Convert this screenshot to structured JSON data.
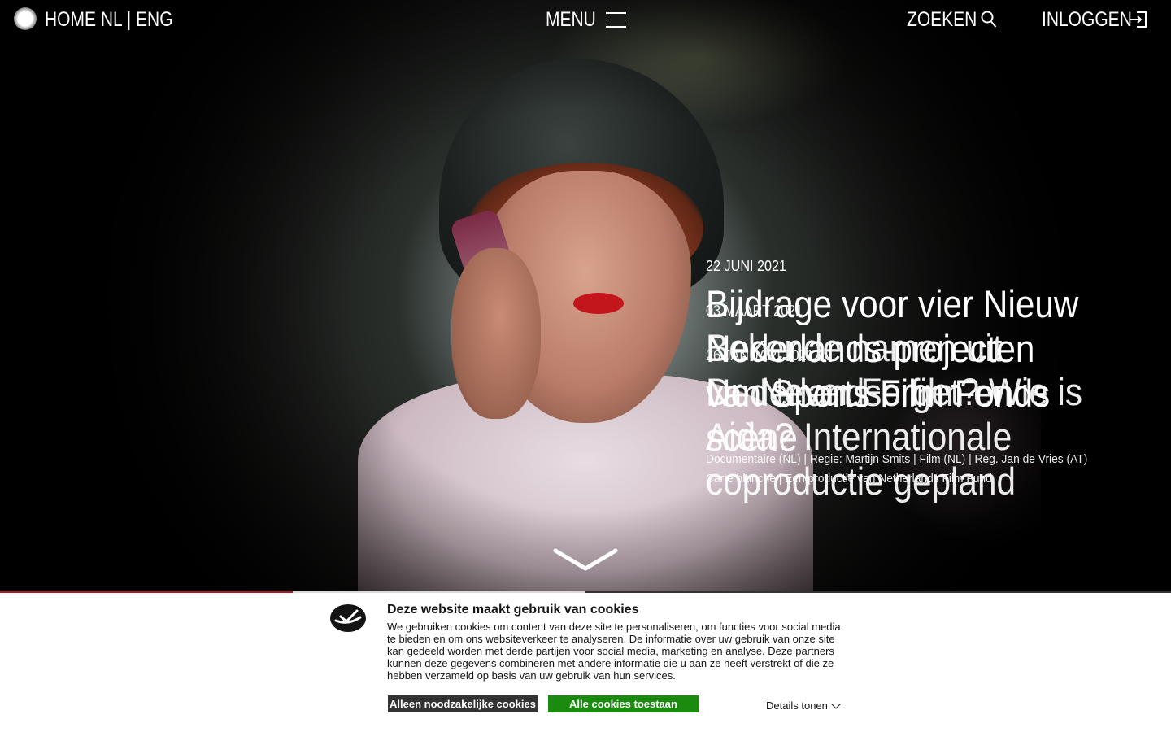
{
  "nav": {
    "home": "HOME",
    "lang_nl": "NL",
    "lang_sep": "|",
    "lang_eng": "ENG",
    "menu": "MENU",
    "search": "ZOEKEN",
    "login": "INLOGGEN"
  },
  "hero": {
    "slides": [
      {
        "date": "22 JUNI 2021",
        "title": "Bijdrage voor vier Nieuw Nederlands-projecten van Sports Film Fonds",
        "subtitle": ""
      },
      {
        "date": "03 MAART 2021",
        "title": "Bekende namen uit Nederlandse film en scène",
        "subtitle": "Documentaire (NL) | Regie: Martijn Smits | Film (NL) | Reg. Jan de Vries (AT)"
      },
      {
        "date": "26 JANUARI 2021",
        "title": "Dr. Never Forget? Wie is Aida? Internationale coproductie gepland",
        "subtitle": "Carte blanche | Een productie van Netherlands Film Fund"
      }
    ]
  },
  "progress": {
    "fraction": 0.25
  },
  "cookie": {
    "title": "Deze website maakt gebruik van cookies",
    "body": "We gebruiken cookies om content van deze site te personaliseren, om functies voor social media te bieden en om ons websiteverkeer te analyseren. De informatie over uw gebruik van onze site kan gedeeld worden met derde partijen voor social media, marketing en analyse. Deze partners kunnen deze gegevens combineren met andere informatie die u aan ze heeft verstrekt of die ze hebben verzameld op basis van uw gebruik van hun services.",
    "btn_necessary": "Alleen noodzakelijke cookies",
    "btn_all": "Alle cookies toestaan",
    "details": "Details tonen"
  },
  "colors": {
    "accent_red": "#b0171f",
    "accept_green": "#1a8b0e",
    "dark_button": "#333333"
  },
  "icons": [
    "logo-dot-icon",
    "hamburger-icon",
    "search-icon",
    "login-icon",
    "chevron-down-icon",
    "cookie-logo-icon"
  ]
}
